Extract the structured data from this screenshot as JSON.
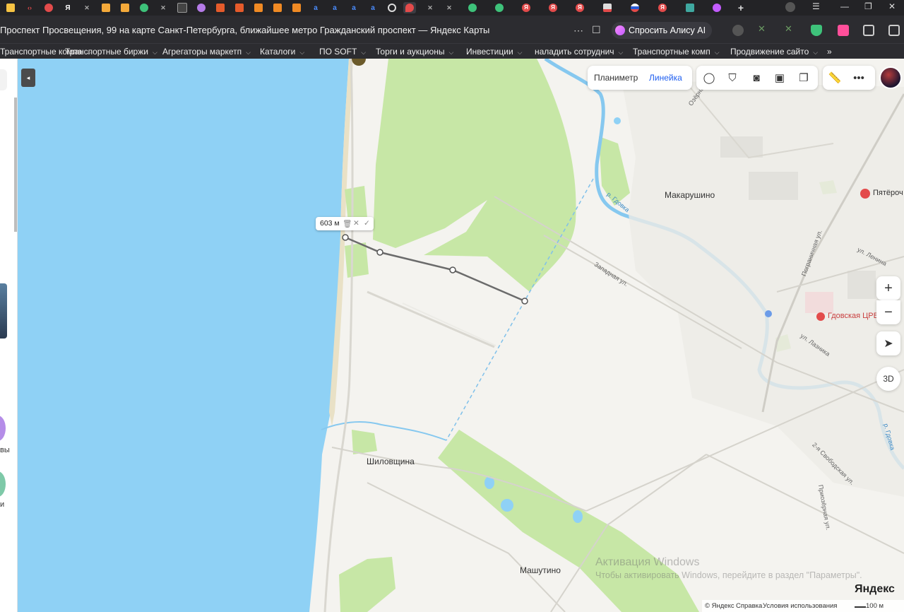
{
  "browser": {
    "tab_count": 31,
    "title": "Проспект Просвещения, 99 на карте Санкт-Петербурга, ближайшее метро Гражданский проспект — Яндекс Карты",
    "alice_button": "Спросить Алису AI",
    "bookmarks": [
      "Транспортные компа",
      "Транспортные биржи",
      "Агрегаторы маркетп",
      "Каталоги",
      "ПО SOFT",
      "Торги и аукционы",
      "Инвестиции",
      "наладить сотруднич",
      "Транспортные комп",
      "Продвижение сайто"
    ],
    "bookmarks_more": "»",
    "tab_icons": {
      "yandex": "Я",
      "auto": "a",
      "new_tab": "+"
    }
  },
  "map": {
    "mode_planimeter": "Планиметр",
    "mode_ruler": "Линейка",
    "ruler_distance": "603 м",
    "zoom_in": "+",
    "zoom_out": "−",
    "view_3d": "3D",
    "places": {
      "makarushino": "Макарушино",
      "shilovshchina": "Шиловщина",
      "mashutino": "Машутино",
      "pyaterochka": "Пятёроч",
      "hospital": "Гдовская ЦРБ"
    },
    "streets": {
      "zapadnaya": "Западная ул.",
      "lenina": "ул. Ленина",
      "pogranichnaya": "Пограничная ул.",
      "laznika": "ул. Лазника",
      "svobodskaya": "2-я Свободская ул.",
      "priozernaya": "Приозёрная ул.",
      "ozernaya": "Озёрная ул.",
      "river": "р. Гдовка",
      "river2": "р. Гдовка"
    },
    "side_text": {
      "a": "вы",
      "b": "и"
    },
    "attribution": {
      "copyright": "© Яндекс",
      "help": "Справка",
      "terms": "Условия использования",
      "scale": "100 м"
    },
    "logo": "Яндекс"
  },
  "windows_watermark": {
    "title": "Активация Windows",
    "subtitle": "Чтобы активировать Windows, перейдите в раздел \"Параметры\"."
  },
  "colors": {
    "water": "#8fd1f5",
    "forest": "#c7e7a6",
    "land": "#f4f3ef",
    "accent": "#1e5ef0",
    "hospital": "#e34b4b"
  },
  "icons": [
    "collapse-icon",
    "bookmark-icon",
    "shield-icon",
    "ruler-icon",
    "more-icon",
    "traffic-icon",
    "panorama-icon",
    "camera-icon",
    "transport-icon",
    "layers-icon",
    "location-icon"
  ]
}
